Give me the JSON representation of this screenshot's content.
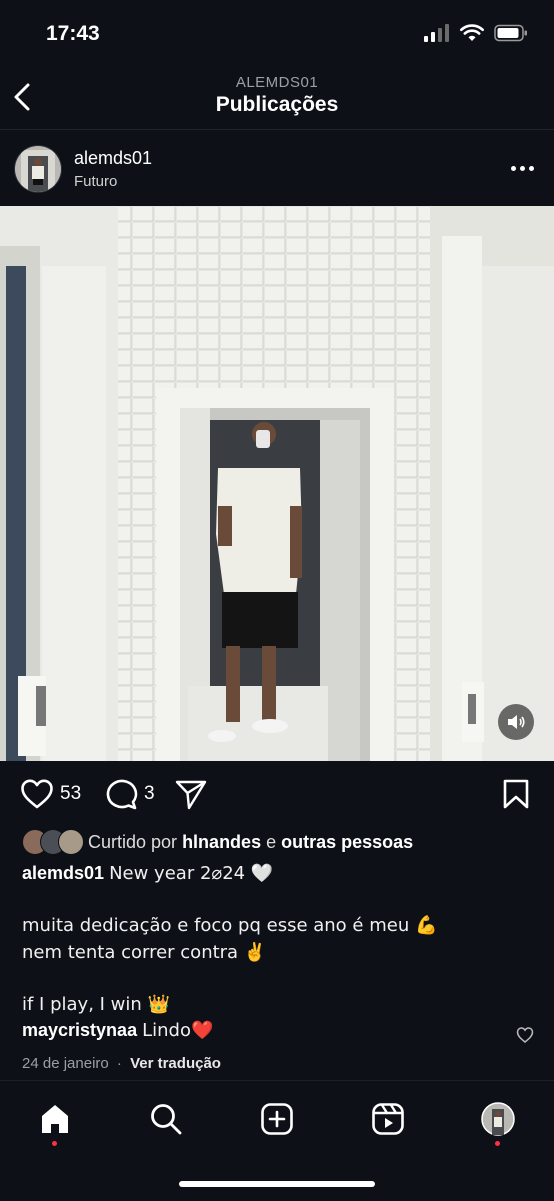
{
  "status_bar": {
    "time": "17:43"
  },
  "header": {
    "subtitle": "ALEMDS01",
    "title": "Publicações"
  },
  "post": {
    "username": "alemds01",
    "location": "Futuro",
    "likes_count": "53",
    "comments_count": "3",
    "liked_by_prefix": "Curtido por",
    "liked_by_user": "hlnandes",
    "liked_by_joiner": "e",
    "liked_by_others": "outras pessoas",
    "caption_user": "alemds01",
    "caption_line1": "New year 2⌀24 🤍",
    "caption_line2": "muita dedicação e foco pq esse ano é meu 💪",
    "caption_line3": "nem tenta correr contra ✌️",
    "caption_line4": "if I play, I win 👑",
    "comment_user": "maycristynaa",
    "comment_text": "Lindo❤️",
    "date": "24 de janeiro",
    "separator": "·",
    "translate_link": "Ver tradução"
  },
  "colors": {
    "background": "#0d1117",
    "notification_dot": "#ff3040"
  }
}
